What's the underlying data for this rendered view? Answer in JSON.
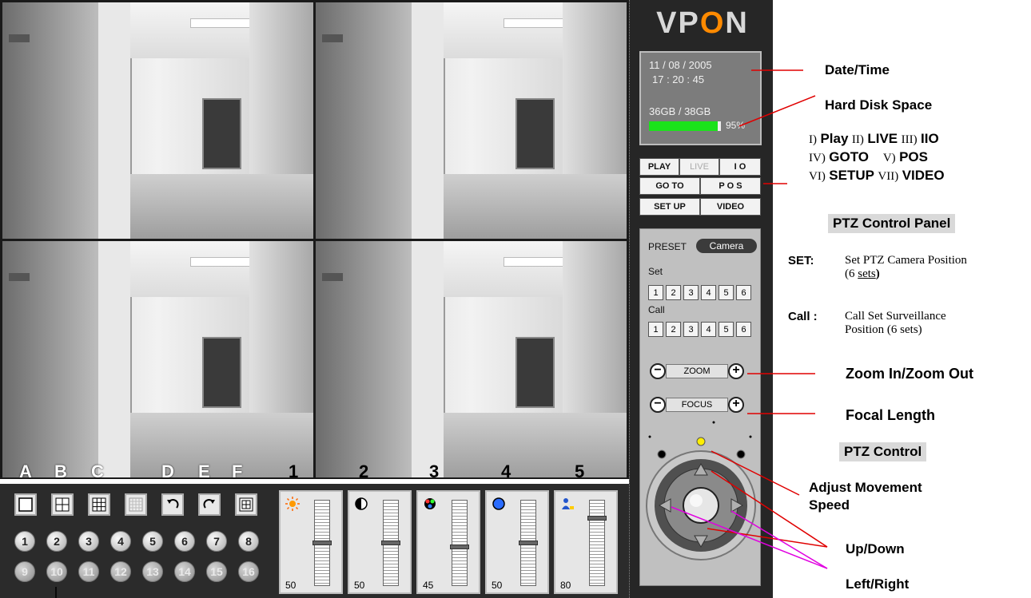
{
  "layout_letters": [
    "A",
    "B",
    "C",
    "D",
    "E",
    "F"
  ],
  "layout_tools": [
    {
      "icon": "single-view-icon"
    },
    {
      "icon": "quad-view-icon"
    },
    {
      "icon": "nine-view-icon"
    },
    {
      "icon": "sixteen-view-icon"
    },
    {
      "icon": "rotate-left-icon"
    },
    {
      "icon": "rotate-right-icon"
    },
    {
      "icon": "picture-in-picture-icon"
    }
  ],
  "camera_numbers": [
    "1",
    "2",
    "3",
    "4",
    "5",
    "6",
    "7",
    "8",
    "9",
    "10",
    "11",
    "12",
    "13",
    "14",
    "15",
    "16"
  ],
  "slider_digits": [
    "1",
    "2",
    "3",
    "4",
    "5"
  ],
  "sliders": [
    {
      "icon": "brightness-icon",
      "value": "50",
      "level": 0.5
    },
    {
      "icon": "contrast-icon",
      "value": "50",
      "level": 0.5
    },
    {
      "icon": "color-icon",
      "value": "45",
      "level": 0.45
    },
    {
      "icon": "saturation-icon",
      "value": "50",
      "level": 0.5
    },
    {
      "icon": "sharpness-icon",
      "value": "80",
      "level": 0.8
    }
  ],
  "panel": {
    "logo_v": "V",
    "logo_p": "P",
    "logo_o": "O",
    "logo_n": "N",
    "date": "11 / 08 / 2005",
    "time": "17 : 20 : 45",
    "disk": "36GB / 38GB",
    "disk_pct": "95%",
    "disk_level": 0.95,
    "modes": {
      "play": "PLAY",
      "live": "LIVE",
      "io": "I O",
      "goto": "GO TO",
      "pos": "P O S",
      "setup": "SET UP",
      "video": "VIDEO"
    },
    "preset": "PRESET",
    "camera": "Camera",
    "set": "Set",
    "call": "Call",
    "nums": [
      "1",
      "2",
      "3",
      "4",
      "5",
      "6"
    ],
    "zoom": "ZOOM",
    "focus": "FOCUS"
  },
  "notes": {
    "datetime": "Date/Time",
    "harddisk": "Hard Disk Space",
    "modes_line1": {
      "r1": "I)",
      "t1": "Play",
      "r2": "II)",
      "t2": "LIVE",
      "r3": "III)",
      "t3": "IIO"
    },
    "modes_line2": {
      "r1": "IV)",
      "t1": "GOTO",
      "r2": "V)",
      "t2": "POS"
    },
    "modes_line3": {
      "r1": "VI)",
      "t1": "SETUP",
      "r2": "VII)",
      "t2": "VIDEO"
    },
    "ptz_panel": "PTZ Control Panel",
    "set_label": "SET:",
    "set_desc1": "Set PTZ Camera Position",
    "set_desc2a": "(6 ",
    "set_desc2b": "sets",
    "set_desc2c": ")",
    "call_label": "Call :",
    "call_desc1": "Call Set Surveillance",
    "call_desc2": "Position (6 sets)",
    "zoom": "Zoom In/Zoom Out",
    "focal": "Focal Length",
    "ptz_control": "PTZ Control",
    "speed1": "Adjust Movement",
    "speed2": "Speed",
    "updown": "Up/Down",
    "leftright": "Left/Right"
  }
}
